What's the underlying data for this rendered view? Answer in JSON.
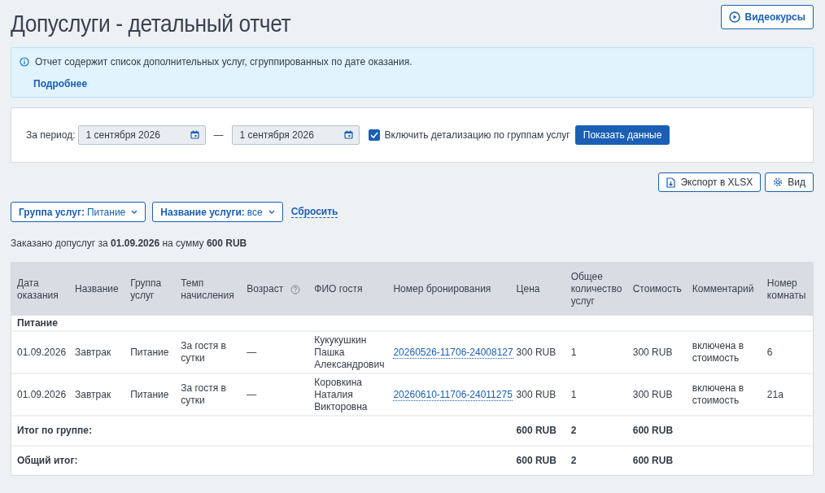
{
  "title": "Допуслуги - детальный отчет",
  "video_button": "Видеокурсы",
  "info": {
    "text": "Отчет содержит список дополнительных услуг, сгруппированных по дате оказания.",
    "link": "Подробнее"
  },
  "filter": {
    "period_label": "За период:",
    "from": "1 сентября 2026",
    "separator": "—",
    "to": "1 сентября 2026",
    "detail_checkbox": {
      "label": "Включить детализацию по группам услуг",
      "checked": true
    },
    "show_button": "Показать данные"
  },
  "export_button": "Экспорт в XLSX",
  "view_button": "Вид",
  "chips": [
    {
      "label": "Группа услуг:",
      "value": "Питание"
    },
    {
      "label": "Название услуги:",
      "value": "все"
    }
  ],
  "reset_link": "Сбросить",
  "summary": "Заказано допуслуг за **01.09.2026** на сумму **600 RUB**",
  "table": {
    "columns": [
      {
        "label": "Дата оказания",
        "help": false
      },
      {
        "label": "Название",
        "help": false
      },
      {
        "label": "Группа услуг",
        "help": false
      },
      {
        "label": "Темп начисления",
        "help": false
      },
      {
        "label": "Возраст",
        "help": true
      },
      {
        "label": "ФИО гостя",
        "help": false
      },
      {
        "label": "Номер бронирования",
        "help": false
      },
      {
        "label": "Цена",
        "help": false
      },
      {
        "label": "Общее количество услуг",
        "help": false
      },
      {
        "label": "Стоимость",
        "help": false
      },
      {
        "label": "Комментарий",
        "help": false
      },
      {
        "label": "Номер комнаты",
        "help": false
      }
    ],
    "rows": [
      {
        "kind": "group",
        "label": "Питание"
      },
      {
        "kind": "data",
        "cells": [
          "01.09.2026",
          "Завтрак",
          "Питание",
          "За гостя в сутки",
          "—",
          "Кукукушкин Пашка Александрович",
          "20260526-11706-24008127",
          "300 RUB",
          "1",
          "300 RUB",
          "включена в стоимость",
          "6"
        ]
      },
      {
        "kind": "data",
        "cells": [
          "01.09.2026",
          "Завтрак",
          "Питание",
          "За гостя в сутки",
          "—",
          "Коровкина Наталия Викторовна",
          "20260610-11706-24011275",
          "300 RUB",
          "1",
          "300 RUB",
          "включена в стоимость",
          "21а"
        ]
      },
      {
        "kind": "total",
        "label": "Итог по группе:",
        "price": "600 RUB",
        "quantity": "2",
        "cost": "600 RUB"
      },
      {
        "kind": "total",
        "label": "Общий итог:",
        "price": "600 RUB",
        "quantity": "2",
        "cost": "600 RUB"
      }
    ]
  }
}
